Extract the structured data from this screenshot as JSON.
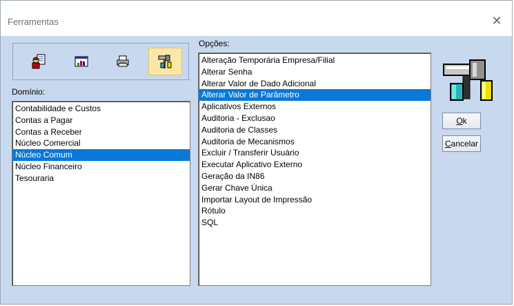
{
  "window": {
    "title": "Ferramentas",
    "close_glyph": "✕"
  },
  "toolbar": {
    "buttons": [
      {
        "icon": "user-document-icon"
      },
      {
        "icon": "chart-window-icon"
      },
      {
        "icon": "printer-icon"
      },
      {
        "icon": "hammer-tools-icon",
        "selected": true
      }
    ]
  },
  "dominio": {
    "label": "Domínio:",
    "items": [
      "Contabilidade e Custos",
      "Contas a Pagar",
      "Contas a Receber",
      "Núcleo Comercial",
      "Núcleo Comum",
      "Núcleo Financeiro",
      "Tesouraria"
    ],
    "selected": "Núcleo Comum"
  },
  "opcoes": {
    "label": "Opções:",
    "items": [
      "Alteração Temporária Empresa/Filial",
      "Alterar Senha",
      "Alterar Valor de Dado Adicional",
      "Alterar Valor de Parâmetro",
      "Aplicativos Externos",
      "Auditoria - Exclusao",
      "Auditoria de Classes",
      "Auditoria de Mecanismos",
      "Excluir / Transferir Usuário",
      "Executar Aplicativo Externo",
      "Geração da IN86",
      "Gerar Chave Única",
      "Importar Layout de Impressão",
      "Rótulo",
      "SQL"
    ],
    "selected": "Alterar Valor de Parâmetro"
  },
  "buttons": {
    "ok": {
      "accel": "O",
      "rest": "k"
    },
    "cancel": {
      "accel": "C",
      "rest": "ancelar"
    }
  },
  "colors": {
    "selection": "#0a78d7",
    "dialog_bg": "#c8d8ee",
    "toolbar_selected": "#fbe7a8"
  }
}
